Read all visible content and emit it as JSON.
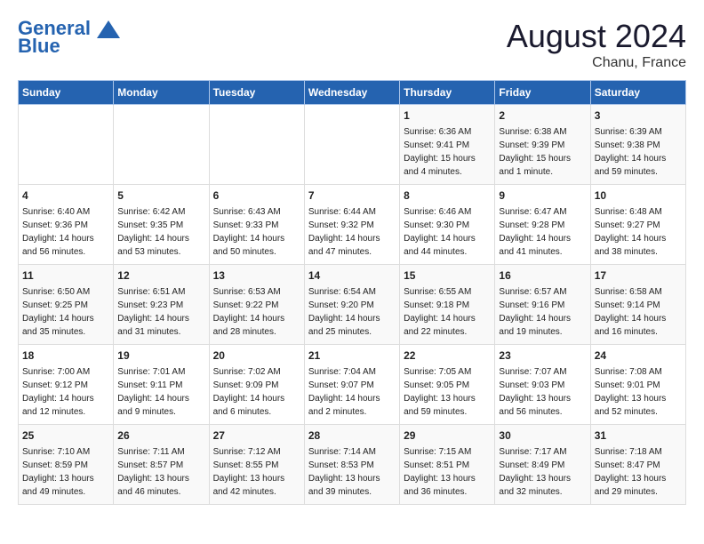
{
  "header": {
    "logo_line1": "General",
    "logo_line2": "Blue",
    "main_title": "August 2024",
    "subtitle": "Chanu, France"
  },
  "days_of_week": [
    "Sunday",
    "Monday",
    "Tuesday",
    "Wednesday",
    "Thursday",
    "Friday",
    "Saturday"
  ],
  "weeks": [
    [
      {
        "day": "",
        "info": ""
      },
      {
        "day": "",
        "info": ""
      },
      {
        "day": "",
        "info": ""
      },
      {
        "day": "",
        "info": ""
      },
      {
        "day": "1",
        "info": "Sunrise: 6:36 AM\nSunset: 9:41 PM\nDaylight: 15 hours\nand 4 minutes."
      },
      {
        "day": "2",
        "info": "Sunrise: 6:38 AM\nSunset: 9:39 PM\nDaylight: 15 hours\nand 1 minute."
      },
      {
        "day": "3",
        "info": "Sunrise: 6:39 AM\nSunset: 9:38 PM\nDaylight: 14 hours\nand 59 minutes."
      }
    ],
    [
      {
        "day": "4",
        "info": "Sunrise: 6:40 AM\nSunset: 9:36 PM\nDaylight: 14 hours\nand 56 minutes."
      },
      {
        "day": "5",
        "info": "Sunrise: 6:42 AM\nSunset: 9:35 PM\nDaylight: 14 hours\nand 53 minutes."
      },
      {
        "day": "6",
        "info": "Sunrise: 6:43 AM\nSunset: 9:33 PM\nDaylight: 14 hours\nand 50 minutes."
      },
      {
        "day": "7",
        "info": "Sunrise: 6:44 AM\nSunset: 9:32 PM\nDaylight: 14 hours\nand 47 minutes."
      },
      {
        "day": "8",
        "info": "Sunrise: 6:46 AM\nSunset: 9:30 PM\nDaylight: 14 hours\nand 44 minutes."
      },
      {
        "day": "9",
        "info": "Sunrise: 6:47 AM\nSunset: 9:28 PM\nDaylight: 14 hours\nand 41 minutes."
      },
      {
        "day": "10",
        "info": "Sunrise: 6:48 AM\nSunset: 9:27 PM\nDaylight: 14 hours\nand 38 minutes."
      }
    ],
    [
      {
        "day": "11",
        "info": "Sunrise: 6:50 AM\nSunset: 9:25 PM\nDaylight: 14 hours\nand 35 minutes."
      },
      {
        "day": "12",
        "info": "Sunrise: 6:51 AM\nSunset: 9:23 PM\nDaylight: 14 hours\nand 31 minutes."
      },
      {
        "day": "13",
        "info": "Sunrise: 6:53 AM\nSunset: 9:22 PM\nDaylight: 14 hours\nand 28 minutes."
      },
      {
        "day": "14",
        "info": "Sunrise: 6:54 AM\nSunset: 9:20 PM\nDaylight: 14 hours\nand 25 minutes."
      },
      {
        "day": "15",
        "info": "Sunrise: 6:55 AM\nSunset: 9:18 PM\nDaylight: 14 hours\nand 22 minutes."
      },
      {
        "day": "16",
        "info": "Sunrise: 6:57 AM\nSunset: 9:16 PM\nDaylight: 14 hours\nand 19 minutes."
      },
      {
        "day": "17",
        "info": "Sunrise: 6:58 AM\nSunset: 9:14 PM\nDaylight: 14 hours\nand 16 minutes."
      }
    ],
    [
      {
        "day": "18",
        "info": "Sunrise: 7:00 AM\nSunset: 9:12 PM\nDaylight: 14 hours\nand 12 minutes."
      },
      {
        "day": "19",
        "info": "Sunrise: 7:01 AM\nSunset: 9:11 PM\nDaylight: 14 hours\nand 9 minutes."
      },
      {
        "day": "20",
        "info": "Sunrise: 7:02 AM\nSunset: 9:09 PM\nDaylight: 14 hours\nand 6 minutes."
      },
      {
        "day": "21",
        "info": "Sunrise: 7:04 AM\nSunset: 9:07 PM\nDaylight: 14 hours\nand 2 minutes."
      },
      {
        "day": "22",
        "info": "Sunrise: 7:05 AM\nSunset: 9:05 PM\nDaylight: 13 hours\nand 59 minutes."
      },
      {
        "day": "23",
        "info": "Sunrise: 7:07 AM\nSunset: 9:03 PM\nDaylight: 13 hours\nand 56 minutes."
      },
      {
        "day": "24",
        "info": "Sunrise: 7:08 AM\nSunset: 9:01 PM\nDaylight: 13 hours\nand 52 minutes."
      }
    ],
    [
      {
        "day": "25",
        "info": "Sunrise: 7:10 AM\nSunset: 8:59 PM\nDaylight: 13 hours\nand 49 minutes."
      },
      {
        "day": "26",
        "info": "Sunrise: 7:11 AM\nSunset: 8:57 PM\nDaylight: 13 hours\nand 46 minutes."
      },
      {
        "day": "27",
        "info": "Sunrise: 7:12 AM\nSunset: 8:55 PM\nDaylight: 13 hours\nand 42 minutes."
      },
      {
        "day": "28",
        "info": "Sunrise: 7:14 AM\nSunset: 8:53 PM\nDaylight: 13 hours\nand 39 minutes."
      },
      {
        "day": "29",
        "info": "Sunrise: 7:15 AM\nSunset: 8:51 PM\nDaylight: 13 hours\nand 36 minutes."
      },
      {
        "day": "30",
        "info": "Sunrise: 7:17 AM\nSunset: 8:49 PM\nDaylight: 13 hours\nand 32 minutes."
      },
      {
        "day": "31",
        "info": "Sunrise: 7:18 AM\nSunset: 8:47 PM\nDaylight: 13 hours\nand 29 minutes."
      }
    ]
  ]
}
